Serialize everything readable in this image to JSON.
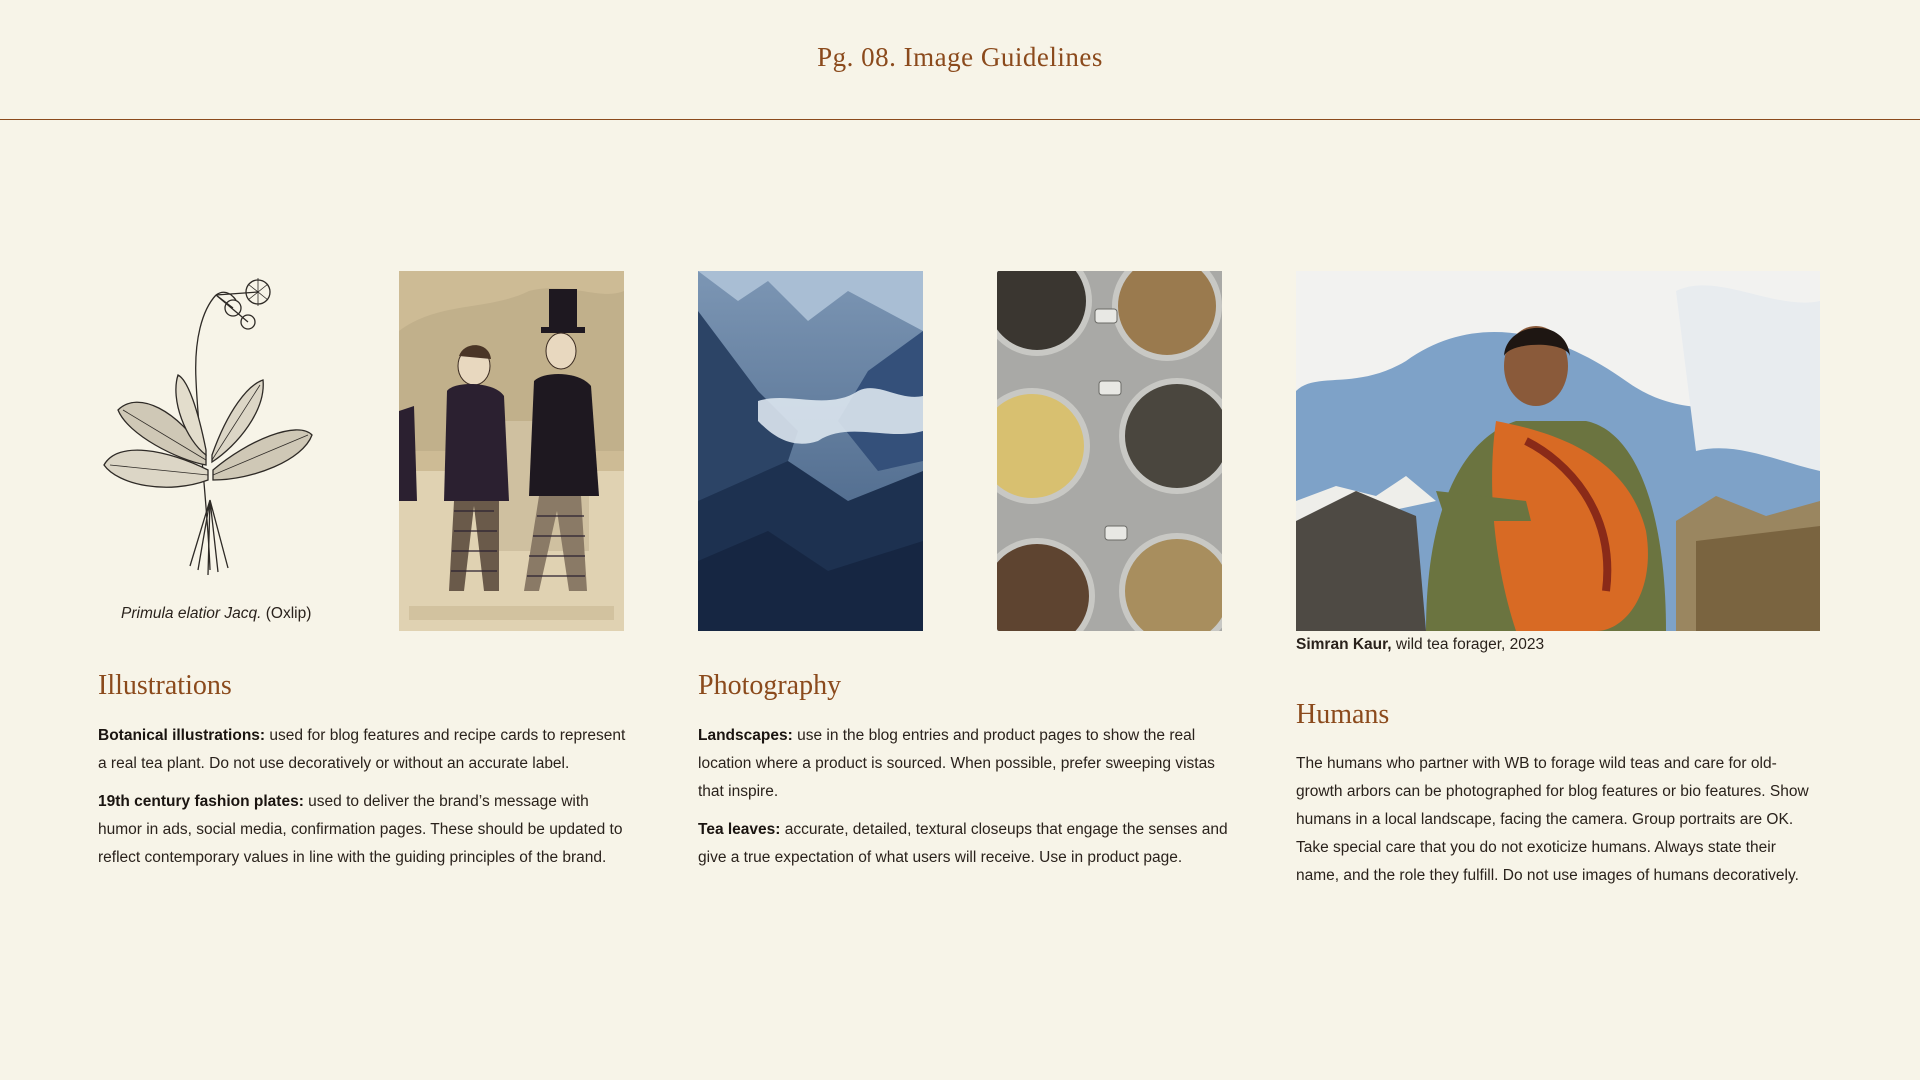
{
  "page": {
    "title": "Pg. 08. Image Guidelines"
  },
  "colors": {
    "background": "#f7f4e8",
    "accent": "#8b4a1c",
    "text": "#2a221c"
  },
  "illustrations": {
    "heading": "Illustrations",
    "oxlip_caption_italic": "Primula elatior Jacq.",
    "oxlip_caption_rest": " (Oxlip)",
    "fashion_plate_text": "",
    "para1_bold": "Botanical illustrations:",
    "para1_text": " used for blog features and recipe cards to represent a real tea plant. Do not use decoratively or without an accurate label.",
    "para2_bold": "19th century fashion plates:",
    "para2_text": " used to deliver the brand’s message with humor in ads, social media, confirmation pages. These should be updated to reflect contemporary values in line with the guiding principles of the brand."
  },
  "photography": {
    "heading": "Photography",
    "para1_bold": "Landscapes:",
    "para1_text": " use in the blog entries and product pages to show the real location where a product is sourced. When possible, prefer sweeping vistas that inspire.",
    "para2_bold": "Tea leaves:",
    "para2_text": " accurate, detailed, textural closeups that engage the senses and give a true expectation of what users will receive. Use in product page."
  },
  "humans": {
    "heading": "Humans",
    "caption_bold": "Simran Kaur,",
    "caption_text": " wild tea forager, 2023",
    "para1_text": "The humans who partner with WB to forage wild teas and care for old-growth arbors can be photographed for blog features or bio features. Show humans in a local landscape, facing the camera. Group portraits are OK. Take special care that you do not exoticize humans. Always state their name, and the role they fulfill. Do not use images of humans decoratively."
  }
}
